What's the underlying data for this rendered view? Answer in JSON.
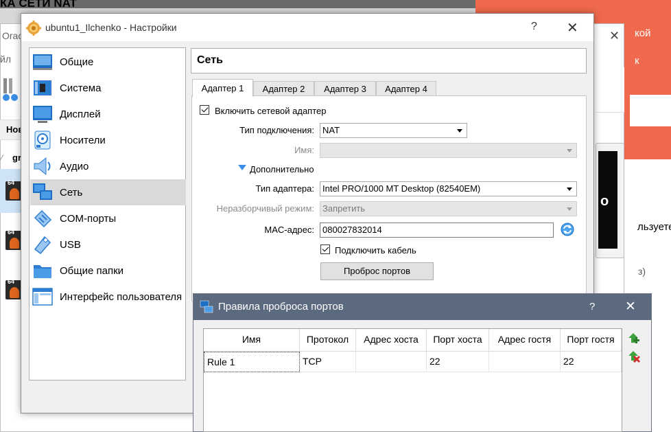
{
  "background": {
    "top_title": "КА СЕТИ NAT",
    "orange_text1": "кой",
    "orange_text2": "к",
    "article_text1": "льзуете",
    "article_text2": "з)",
    "video_char": "о",
    "main_window": {
      "partial_title": "Orac",
      "menu_partial": "йл",
      "new_label": "Нов",
      "vm_group": "gr",
      "vm_badge": "64"
    }
  },
  "settings": {
    "title": "ubuntu1_Ilchenko - Настройки",
    "help": "?",
    "close": "✕",
    "nav_items": [
      {
        "label": "Общие",
        "icon": "general-icon"
      },
      {
        "label": "Система",
        "icon": "system-icon"
      },
      {
        "label": "Дисплей",
        "icon": "display-icon"
      },
      {
        "label": "Носители",
        "icon": "storage-icon"
      },
      {
        "label": "Аудио",
        "icon": "audio-icon"
      },
      {
        "label": "Сеть",
        "icon": "network-icon"
      },
      {
        "label": "COM-порты",
        "icon": "serial-port-icon"
      },
      {
        "label": "USB",
        "icon": "usb-icon"
      },
      {
        "label": "Общие папки",
        "icon": "shared-folder-icon"
      },
      {
        "label": "Интерфейс пользователя",
        "icon": "user-interface-icon"
      }
    ],
    "selected_nav": "Сеть",
    "section_title": "Сеть",
    "tabs": [
      "Адаптер 1",
      "Адаптер 2",
      "Адаптер 3",
      "Адаптер 4"
    ],
    "active_tab": "Адаптер 1",
    "adapter": {
      "enable_label": "Включить сетевой адаптер",
      "enabled": true,
      "attached_label": "Тип подключения:",
      "attached_value": "NAT",
      "name_label": "Имя:",
      "name_value": "",
      "advanced_label": "Дополнительно",
      "adapter_type_label": "Тип адаптера:",
      "adapter_type_value": "Intel PRO/1000 MT Desktop (82540EM)",
      "promisc_label": "Неразборчивый режим:",
      "promisc_value": "Запретить",
      "mac_label": "MAC-адрес:",
      "mac_value": "080027832014",
      "cable_label": "Подключить кабель",
      "cable_connected": true,
      "port_forwarding_button": "Проброс портов"
    }
  },
  "port_forwarding": {
    "title": "Правила проброса портов",
    "help": "?",
    "close": "✕",
    "columns": [
      "Имя",
      "Протокол",
      "Адрес хоста",
      "Порт хоста",
      "Адрес гостя",
      "Порт гостя"
    ],
    "rows": [
      [
        "Rule 1",
        "TCP",
        "",
        "22",
        "",
        "22"
      ]
    ]
  },
  "colors": {
    "accent_blue": "#3a8ee6",
    "pf_titlebar": "#5c6a80",
    "selection": "#d9d9d9",
    "orange_bg": "#f0694d"
  }
}
